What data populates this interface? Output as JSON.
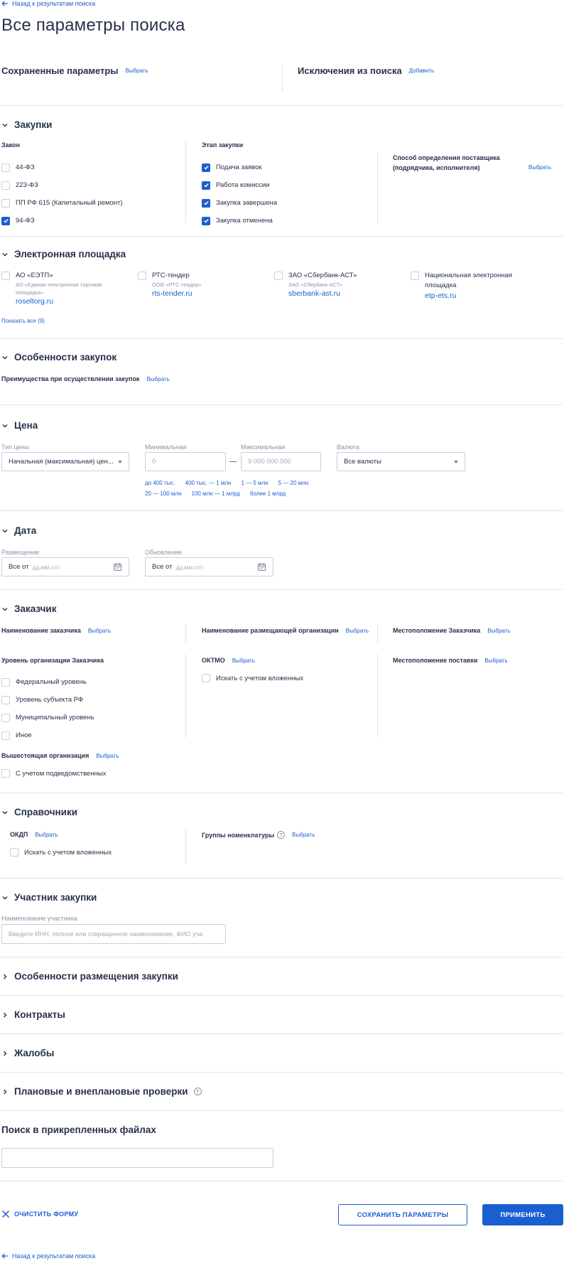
{
  "nav": {
    "back_label": "Назад к результатам поиска"
  },
  "page": {
    "title": "Все параметры поиска"
  },
  "saved": {
    "title": "Сохраненные параметры",
    "action": "Выбрать"
  },
  "exclusions": {
    "title": "Исключения из поиска",
    "action": "Добавить"
  },
  "purchases": {
    "title": "Закупки",
    "law_label": "Закон",
    "laws": [
      {
        "label": "44-ФЗ",
        "checked": false
      },
      {
        "label": "223-ФЗ",
        "checked": false
      },
      {
        "label": "ПП РФ 615 (Капитальный ремонт)",
        "checked": false
      },
      {
        "label": "94-ФЗ",
        "checked": true
      }
    ],
    "stage_label": "Этап закупки",
    "stages": [
      {
        "label": "Подача заявок",
        "checked": true
      },
      {
        "label": "Работа комиссии",
        "checked": true
      },
      {
        "label": "Закупка завершена",
        "checked": true
      },
      {
        "label": "Закупка отменена",
        "checked": true
      }
    ],
    "method_label_1": "Способ определения поставщика",
    "method_label_2": "(подрядчика, исполнителя)",
    "method_action": "Выбрать"
  },
  "platforms": {
    "title": "Электронная площадка",
    "items": [
      {
        "name": "АО «ЕЭТП»",
        "sub1": "АО «Единая электронная торговая",
        "sub2": "площадка»",
        "url": "roseltorg.ru"
      },
      {
        "name": "РТС-тендер",
        "sub1": "ООО «РТС-тендер»",
        "url": "rts-tender.ru"
      },
      {
        "name": "ЗАО «Сбербанк-АСТ»",
        "sub1": "ЗАО «Сбербанк-АСТ»",
        "url": "sberbank-ast.ru"
      },
      {
        "name1": "Национальная электронная",
        "name2": "площадка",
        "url": "etp-ets.ru"
      }
    ],
    "show_all": "Показать все (9)"
  },
  "features": {
    "title": "Особенности закупок",
    "advantages_label": "Преимущества при осуществлении закупок",
    "action": "Выбрать"
  },
  "price": {
    "title": "Цена",
    "type_label": "Тип цены",
    "type_value": "Начальная (максимальная) цен...",
    "min_label": "Минимальная",
    "min_placeholder": "0",
    "dash": "—",
    "max_label": "Максимальная",
    "max_placeholder": "9 000 000 000",
    "currency_label": "Валюта",
    "currency_value": "Все валюты",
    "ranges_row1": [
      "до 400 тыс.",
      "400 тыс. — 1 млн",
      "1 — 5 млн",
      "5 — 20 млн"
    ],
    "ranges_row2": [
      "20 — 100 млн",
      "100 млн — 1 млрд",
      "более 1 млрд"
    ]
  },
  "date": {
    "title": "Дата",
    "placement_label": "Размещение",
    "update_label": "Обновление",
    "prefix": "Все от",
    "placeholder": "дд.мм.гггг"
  },
  "customer": {
    "title": "Заказчик",
    "name_label": "Наименование заказчика",
    "placing_org_label": "Наименование размещающей организации",
    "location_label": "Местоположение Заказчика",
    "action": "Выбрать",
    "level_label": "Уровень организации Заказчика",
    "levels": [
      "Федеральный уровень",
      "Уровень субъекта РФ",
      "Муниципальный уровень",
      "Иное"
    ],
    "oktmo_label": "ОКТМО",
    "oktmo_nested": "Искать с учетом вложенных",
    "delivery_label": "Местоположение поставки",
    "parent_org_label": "Вышестоящая организация",
    "parent_org_check": "С учетом подведомственных"
  },
  "references": {
    "title": "Справочники",
    "okdp_label": "ОКДП",
    "action": "Выбрать",
    "okdp_nested": "Искать с учетом вложенных",
    "groups_label": "Группы номенклатуры",
    "help": "?"
  },
  "participant": {
    "title": "Участник закупки",
    "name_label": "Наименование участника",
    "placeholder": "Введите ИНН, полное или сокращенное наименование, ФИО уча"
  },
  "collapsed": {
    "placement_features": "Особенности размещения закупки",
    "contracts": "Контракты",
    "complaints": "Жалобы",
    "inspections": "Плановые и внеплановые проверки"
  },
  "files": {
    "title": "Поиск в прикрепленных файлах",
    "value": ""
  },
  "actions": {
    "clear": "ОЧИСТИТЬ ФОРМУ",
    "save": "СОХРАНИТЬ ПАРАМЕТРЫ",
    "apply": "ПРИМЕНИТЬ"
  },
  "colors": {
    "accent": "#1a5fd1",
    "text": "#27314a",
    "muted": "#8a94a6",
    "divider": "#e1e4ea"
  }
}
